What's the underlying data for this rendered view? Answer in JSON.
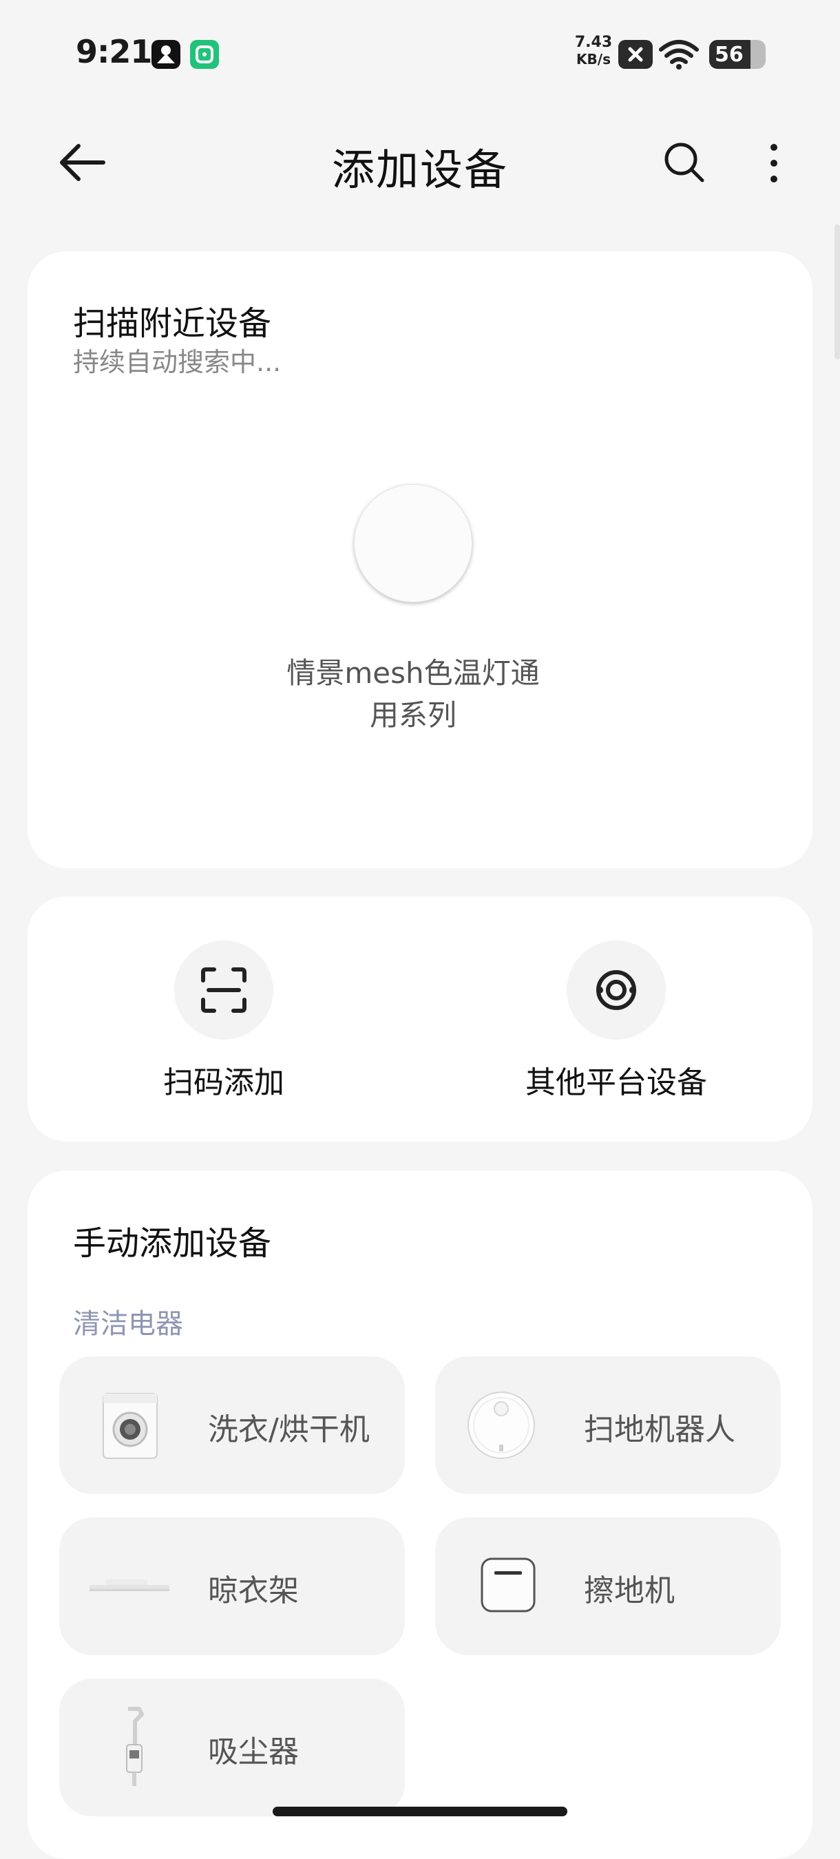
{
  "status_bar": {
    "time": "9:21",
    "net_speed": "7.43",
    "net_unit": "KB/s",
    "battery": "56",
    "icons": [
      "app-notification-icon",
      "mi-home-icon",
      "close-box-icon",
      "wifi-icon",
      "battery-icon"
    ]
  },
  "header": {
    "title": "添加设备",
    "icons": [
      "back-arrow-icon",
      "search-icon",
      "more-vertical-icon"
    ]
  },
  "scan": {
    "title": "扫描附近设备",
    "subtitle": "持续自动搜索中...",
    "device_name": "情景mesh色温灯通用系列"
  },
  "quick_actions": [
    {
      "label": "扫码添加",
      "icon": "scan-qr-icon"
    },
    {
      "label": "其他平台设备",
      "icon": "other-platform-icon"
    }
  ],
  "manual": {
    "title": "手动添加设备",
    "category": "清洁电器",
    "items": [
      {
        "label": "洗衣/烘干机",
        "icon": "washer-dryer-icon"
      },
      {
        "label": "扫地机器人",
        "icon": "robot-vacuum-icon"
      },
      {
        "label": "晾衣架",
        "icon": "clothes-rack-icon"
      },
      {
        "label": "擦地机",
        "icon": "floor-mopper-icon"
      },
      {
        "label": "吸尘器",
        "icon": "vacuum-cleaner-icon"
      }
    ]
  },
  "colors": {
    "background": "#f5f5f5",
    "card": "#ffffff",
    "tile": "#f3f3f3",
    "category_text": "#8f96b2",
    "mi_home_green": "#22c27a"
  }
}
